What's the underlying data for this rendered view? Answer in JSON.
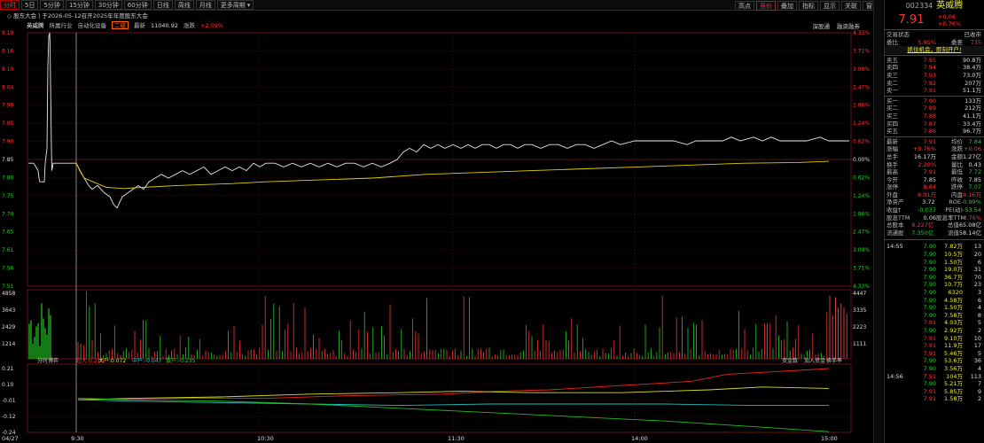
{
  "toolbar": {
    "tabs": [
      "分时",
      "5日",
      "5分钟",
      "15分钟",
      "30分钟",
      "60分钟",
      "日线",
      "周线",
      "月线",
      "更多周期 ▾"
    ],
    "right": [
      "高点",
      "竞价",
      "叠加",
      "指标",
      "显示",
      "关联",
      "窗口"
    ]
  },
  "announcement": "股东大会 | 于2026-05-12召开2025年年度股东大会",
  "header": {
    "name": "英威腾",
    "industry": "所属行业",
    "sector": "自动化设备",
    "tag": "二级",
    "index_label": "最新",
    "index_value": "11040.92",
    "chg_label": "涨跌",
    "chg_value": "+2.09%",
    "right_links": [
      "深股通",
      "融资融券"
    ]
  },
  "left_axis": [
    "8.19",
    "8.16",
    "8.10",
    "8.04",
    "7.99",
    "7.95",
    "7.90",
    "7.85",
    "7.80",
    "7.75",
    "7.70",
    "7.65",
    "7.61",
    "7.56",
    "7.51"
  ],
  "right_axis": [
    "4.33%",
    "3.71%",
    "3.09%",
    "2.47%",
    "1.86%",
    "1.24%",
    "0.62%",
    "0.00%",
    "0.62%",
    "1.24%",
    "1.86%",
    "2.47%",
    "3.09%",
    "3.71%",
    "4.33%"
  ],
  "vol_left": [
    "4858",
    "3643",
    "2429",
    "1214"
  ],
  "vol_right": [
    "4447",
    "3335",
    "2223",
    "1111"
  ],
  "flow": {
    "title": "分时博弈",
    "items": [
      {
        "label": "超大:",
        "value": "0.210"
      },
      {
        "label": "大户:",
        "value": "0.072"
      },
      {
        "label": "中户:",
        "value": "-0.047"
      },
      {
        "label": "散户:",
        "value": "-0.235"
      }
    ],
    "right": [
      "资金数",
      "加入资金",
      "换手率"
    ],
    "axis": [
      "0.21",
      "0.10",
      "-0.01",
      "-0.12",
      "-0.24"
    ]
  },
  "time_axis": [
    "04/27",
    "9:30",
    "10:30",
    "11:30",
    "14:00",
    "15:00"
  ],
  "side": {
    "code": "002334",
    "name": "英威腾",
    "price": "7.91",
    "chg": "+0.06",
    "pct": "+0.76%",
    "status_label": "交易状态",
    "status": "已收市",
    "wb_label": "委比",
    "wb": "5.95%",
    "wc_label": "委差",
    "wc": "735",
    "ad": "抓住机会，即刻开户!",
    "asks": [
      [
        "卖五",
        "7.95",
        "90.8万"
      ],
      [
        "卖四",
        "7.94",
        "38.4万"
      ],
      [
        "卖三",
        "7.93",
        "73.0万"
      ],
      [
        "卖二",
        "7.92",
        "207万"
      ],
      [
        "卖一",
        "7.91",
        "51.1万"
      ]
    ],
    "bids": [
      [
        "买一",
        "7.90",
        "133万"
      ],
      [
        "买二",
        "7.89",
        "212万"
      ],
      [
        "买三",
        "7.88",
        "41.1万"
      ],
      [
        "买四",
        "7.87",
        "33.4万"
      ],
      [
        "买五",
        "7.86",
        "96.7万"
      ]
    ],
    "stats": [
      [
        "最新",
        "7.91",
        "均价",
        "7.84"
      ],
      [
        "涨幅",
        "+0.76%",
        "涨跌",
        "+0.06"
      ],
      [
        "总手",
        "16.17万",
        "金额",
        "1.27亿"
      ],
      [
        "换手",
        "2.20%",
        "量比",
        "0.43"
      ],
      [
        "最高",
        "7.91",
        "最低",
        "7.72"
      ],
      [
        "今开",
        "7.85",
        "昨收",
        "7.85"
      ],
      [
        "涨停",
        "8.64",
        "跌停",
        "7.07"
      ],
      [
        "外盘",
        "8.01万",
        "内盘",
        "8.16万"
      ],
      [
        "净资产",
        "3.72",
        "ROE",
        "-0.99%"
      ],
      [
        "收益†",
        "-0.037",
        "PE(动)",
        "-53.54"
      ],
      [
        "股息TTM",
        "0.06",
        "股息率TTM",
        "0.76%"
      ],
      [
        "总股本",
        "8.227亿",
        "总值",
        "65.08亿"
      ],
      [
        "流通股",
        "7.350亿",
        "流值",
        "58.14亿"
      ]
    ],
    "ticks": [
      [
        "14:55",
        "7.90",
        "7.82万",
        "13"
      ],
      [
        "",
        "7.90",
        "10.5万",
        "20"
      ],
      [
        "",
        "7.90",
        "1.50万",
        "6"
      ],
      [
        "",
        "7.90",
        "19.0万",
        "31"
      ],
      [
        "",
        "7.90",
        "36.7万",
        "70"
      ],
      [
        "",
        "7.90",
        "10.7万",
        "23"
      ],
      [
        "",
        "7.90",
        "6320",
        "3"
      ],
      [
        "",
        "7.90",
        "4.58万",
        "6"
      ],
      [
        "",
        "7.90",
        "1.50万",
        "4"
      ],
      [
        "",
        "7.90",
        "7.58万",
        "8"
      ],
      [
        "",
        "7.91",
        "4.03万",
        "5"
      ],
      [
        "",
        "7.90",
        "2.92万",
        "2"
      ],
      [
        "",
        "7.91",
        "9.10万",
        "10"
      ],
      [
        "",
        "7.91",
        "11.9万",
        "17"
      ],
      [
        "",
        "7.91",
        "5.46万",
        "5"
      ],
      [
        "",
        "7.90",
        "53.6万",
        "36"
      ],
      [
        "",
        "7.90",
        "3.56万",
        "4"
      ],
      [
        "14:56",
        "7.91",
        "104万",
        "113"
      ],
      [
        "",
        "7.90",
        "5.21万",
        "7"
      ],
      [
        "",
        "7.91",
        "5.85万",
        "9"
      ],
      [
        "",
        "7.91",
        "1.58万",
        "2"
      ]
    ]
  }
}
